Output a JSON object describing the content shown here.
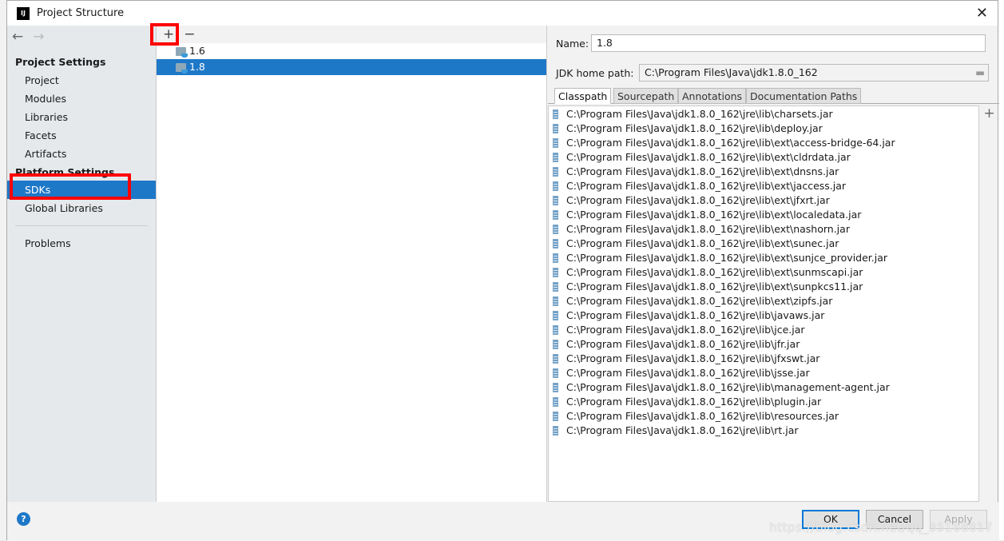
{
  "window": {
    "title": "Project Structure",
    "logo": "IJ",
    "close": "✕"
  },
  "sidebar": {
    "back": "←",
    "forward": "→",
    "project_settings": "Project Settings",
    "project_items": [
      "Project",
      "Modules",
      "Libraries",
      "Facets",
      "Artifacts"
    ],
    "platform_settings": "Platform Settings",
    "platform_items": [
      "SDKs",
      "Global Libraries"
    ],
    "problems": "Problems"
  },
  "sdk_list": {
    "add": "+",
    "remove": "−",
    "items": [
      "1.6",
      "1.8"
    ],
    "selected": "1.8"
  },
  "detail": {
    "name_label": "Name:",
    "name_value": "1.8",
    "home_label": "JDK home path:",
    "home_value": "C:\\Program Files\\Java\\jdk1.8.0_162",
    "tabs": [
      "Classpath",
      "Sourcepath",
      "Annotations",
      "Documentation Paths"
    ],
    "active_tab": "Classpath",
    "add": "+",
    "classpath": [
      "C:\\Program Files\\Java\\jdk1.8.0_162\\jre\\lib\\charsets.jar",
      "C:\\Program Files\\Java\\jdk1.8.0_162\\jre\\lib\\deploy.jar",
      "C:\\Program Files\\Java\\jdk1.8.0_162\\jre\\lib\\ext\\access-bridge-64.jar",
      "C:\\Program Files\\Java\\jdk1.8.0_162\\jre\\lib\\ext\\cldrdata.jar",
      "C:\\Program Files\\Java\\jdk1.8.0_162\\jre\\lib\\ext\\dnsns.jar",
      "C:\\Program Files\\Java\\jdk1.8.0_162\\jre\\lib\\ext\\jaccess.jar",
      "C:\\Program Files\\Java\\jdk1.8.0_162\\jre\\lib\\ext\\jfxrt.jar",
      "C:\\Program Files\\Java\\jdk1.8.0_162\\jre\\lib\\ext\\localedata.jar",
      "C:\\Program Files\\Java\\jdk1.8.0_162\\jre\\lib\\ext\\nashorn.jar",
      "C:\\Program Files\\Java\\jdk1.8.0_162\\jre\\lib\\ext\\sunec.jar",
      "C:\\Program Files\\Java\\jdk1.8.0_162\\jre\\lib\\ext\\sunjce_provider.jar",
      "C:\\Program Files\\Java\\jdk1.8.0_162\\jre\\lib\\ext\\sunmscapi.jar",
      "C:\\Program Files\\Java\\jdk1.8.0_162\\jre\\lib\\ext\\sunpkcs11.jar",
      "C:\\Program Files\\Java\\jdk1.8.0_162\\jre\\lib\\ext\\zipfs.jar",
      "C:\\Program Files\\Java\\jdk1.8.0_162\\jre\\lib\\javaws.jar",
      "C:\\Program Files\\Java\\jdk1.8.0_162\\jre\\lib\\jce.jar",
      "C:\\Program Files\\Java\\jdk1.8.0_162\\jre\\lib\\jfr.jar",
      "C:\\Program Files\\Java\\jdk1.8.0_162\\jre\\lib\\jfxswt.jar",
      "C:\\Program Files\\Java\\jdk1.8.0_162\\jre\\lib\\jsse.jar",
      "C:\\Program Files\\Java\\jdk1.8.0_162\\jre\\lib\\management-agent.jar",
      "C:\\Program Files\\Java\\jdk1.8.0_162\\jre\\lib\\plugin.jar",
      "C:\\Program Files\\Java\\jdk1.8.0_162\\jre\\lib\\resources.jar",
      "C:\\Program Files\\Java\\jdk1.8.0_162\\jre\\lib\\rt.jar"
    ]
  },
  "footer": {
    "help": "?",
    "ok": "OK",
    "cancel": "Cancel",
    "apply": "Apply"
  },
  "watermark": "https://blog.csdn.net/qq_35168817",
  "colors": {
    "selection": "#1e78c8",
    "highlight": "#ff0000"
  }
}
